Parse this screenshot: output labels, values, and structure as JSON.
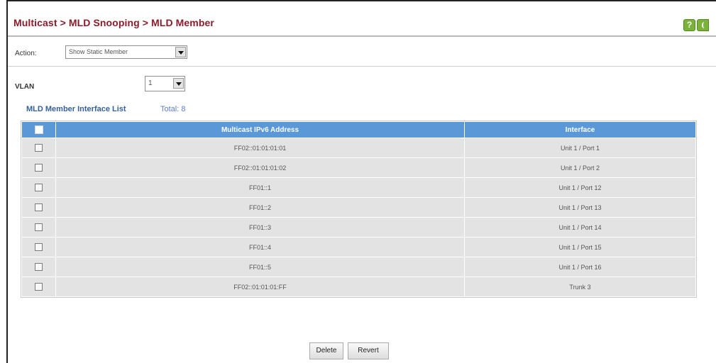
{
  "header": {
    "breadcrumb": "Multicast > MLD Snooping > MLD Member",
    "help_icon": "question-help-icon",
    "secondary_icon": "green-toolbar-icon"
  },
  "action": {
    "label": "Action:",
    "value": "Show Static Member"
  },
  "vlan": {
    "label": "VLAN",
    "value": "1"
  },
  "member_list": {
    "title": "MLD Member Interface List",
    "total": "Total: 8",
    "columns": [
      "Multicast IPv6 Address",
      "Interface"
    ],
    "rows": [
      {
        "address": "FF02::01:01:01:01",
        "interface": "Unit 1 / Port 1",
        "checked": false
      },
      {
        "address": "FF02::01:01:01:02",
        "interface": "Unit 1 / Port 2",
        "checked": false
      },
      {
        "address": "FF01::1",
        "interface": "Unit 1 / Port 12",
        "checked": false
      },
      {
        "address": "FF01::2",
        "interface": "Unit 1 / Port 13",
        "checked": false
      },
      {
        "address": "FF01::3",
        "interface": "Unit 1 / Port 14",
        "checked": false
      },
      {
        "address": "FF01::4",
        "interface": "Unit 1 / Port 15",
        "checked": false
      },
      {
        "address": "FF01::5",
        "interface": "Unit 1 / Port 16",
        "checked": false
      },
      {
        "address": "FF02::01:01:01:FF",
        "interface": "Trunk 3",
        "checked": false
      }
    ]
  },
  "buttons": {
    "delete": "Delete",
    "revert": "Revert"
  },
  "colors": {
    "title": "#8a1c2b",
    "table_header": "#5b98d8",
    "table_row": "#e3e3e3",
    "list_title": "#355f9c",
    "icon_green": "#7bb33a"
  }
}
